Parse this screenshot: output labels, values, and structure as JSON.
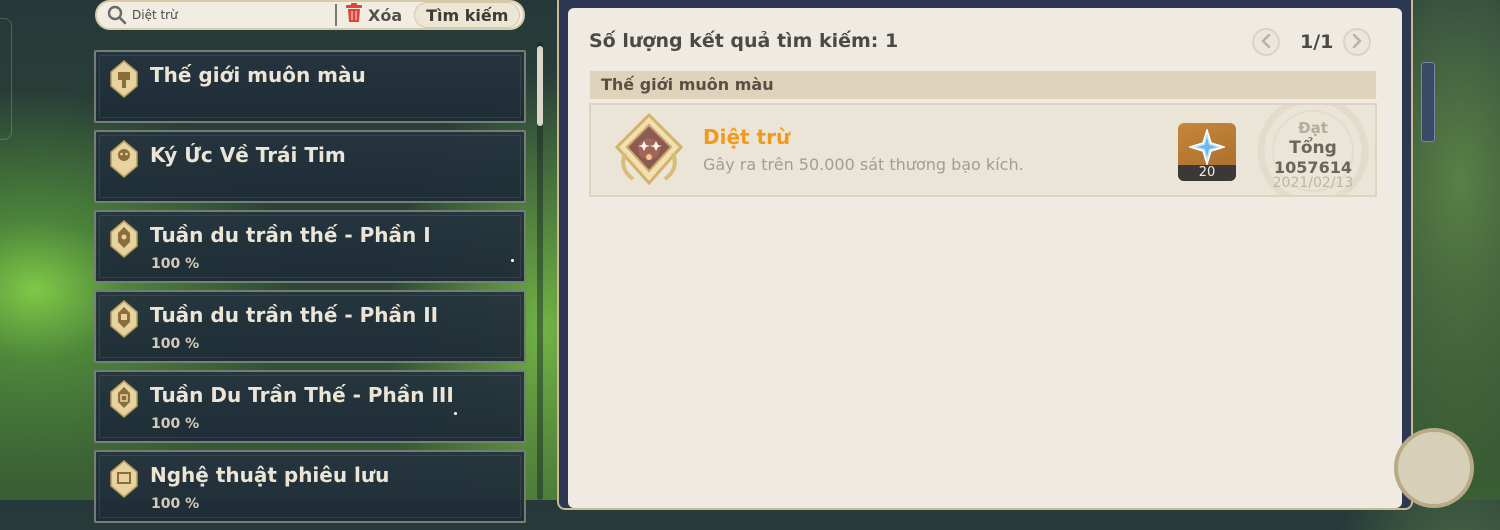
{
  "search": {
    "value": "Diệt trừ",
    "delete_label": "Xóa",
    "search_label": "Tìm kiếm"
  },
  "achievement_list": [
    {
      "title": "Thế giới muôn màu",
      "progress": ""
    },
    {
      "title": "Ký Ức Về Trái Tim",
      "progress": ""
    },
    {
      "title": "Tuần du trần thế - Phần I",
      "progress": "100 %"
    },
    {
      "title": "Tuần du trần thế - Phần II",
      "progress": "100 %"
    },
    {
      "title": "Tuần Du Trần Thế - Phần III",
      "progress": "100 %"
    },
    {
      "title": "Nghệ thuật phiêu lưu",
      "progress": "100 %"
    }
  ],
  "results": {
    "count_label": "Số lượng kết quả tìm kiếm: 1",
    "pager": "1/1",
    "category": "Thế giới muôn màu",
    "item": {
      "title": "Diệt trừ",
      "description": "Gây ra trên 50.000 sát thương bạo kích.",
      "reward_count": "20",
      "stamp_status": "Đạt",
      "stamp_label": "Tổng",
      "stamp_value": "1057614",
      "stamp_date": "2021/02/13"
    }
  },
  "colors": {
    "accent_orange": "#f39a1c",
    "panel_bg": "#efebe3",
    "card_bg": "#25343e",
    "gold": "#d8bd7a"
  }
}
